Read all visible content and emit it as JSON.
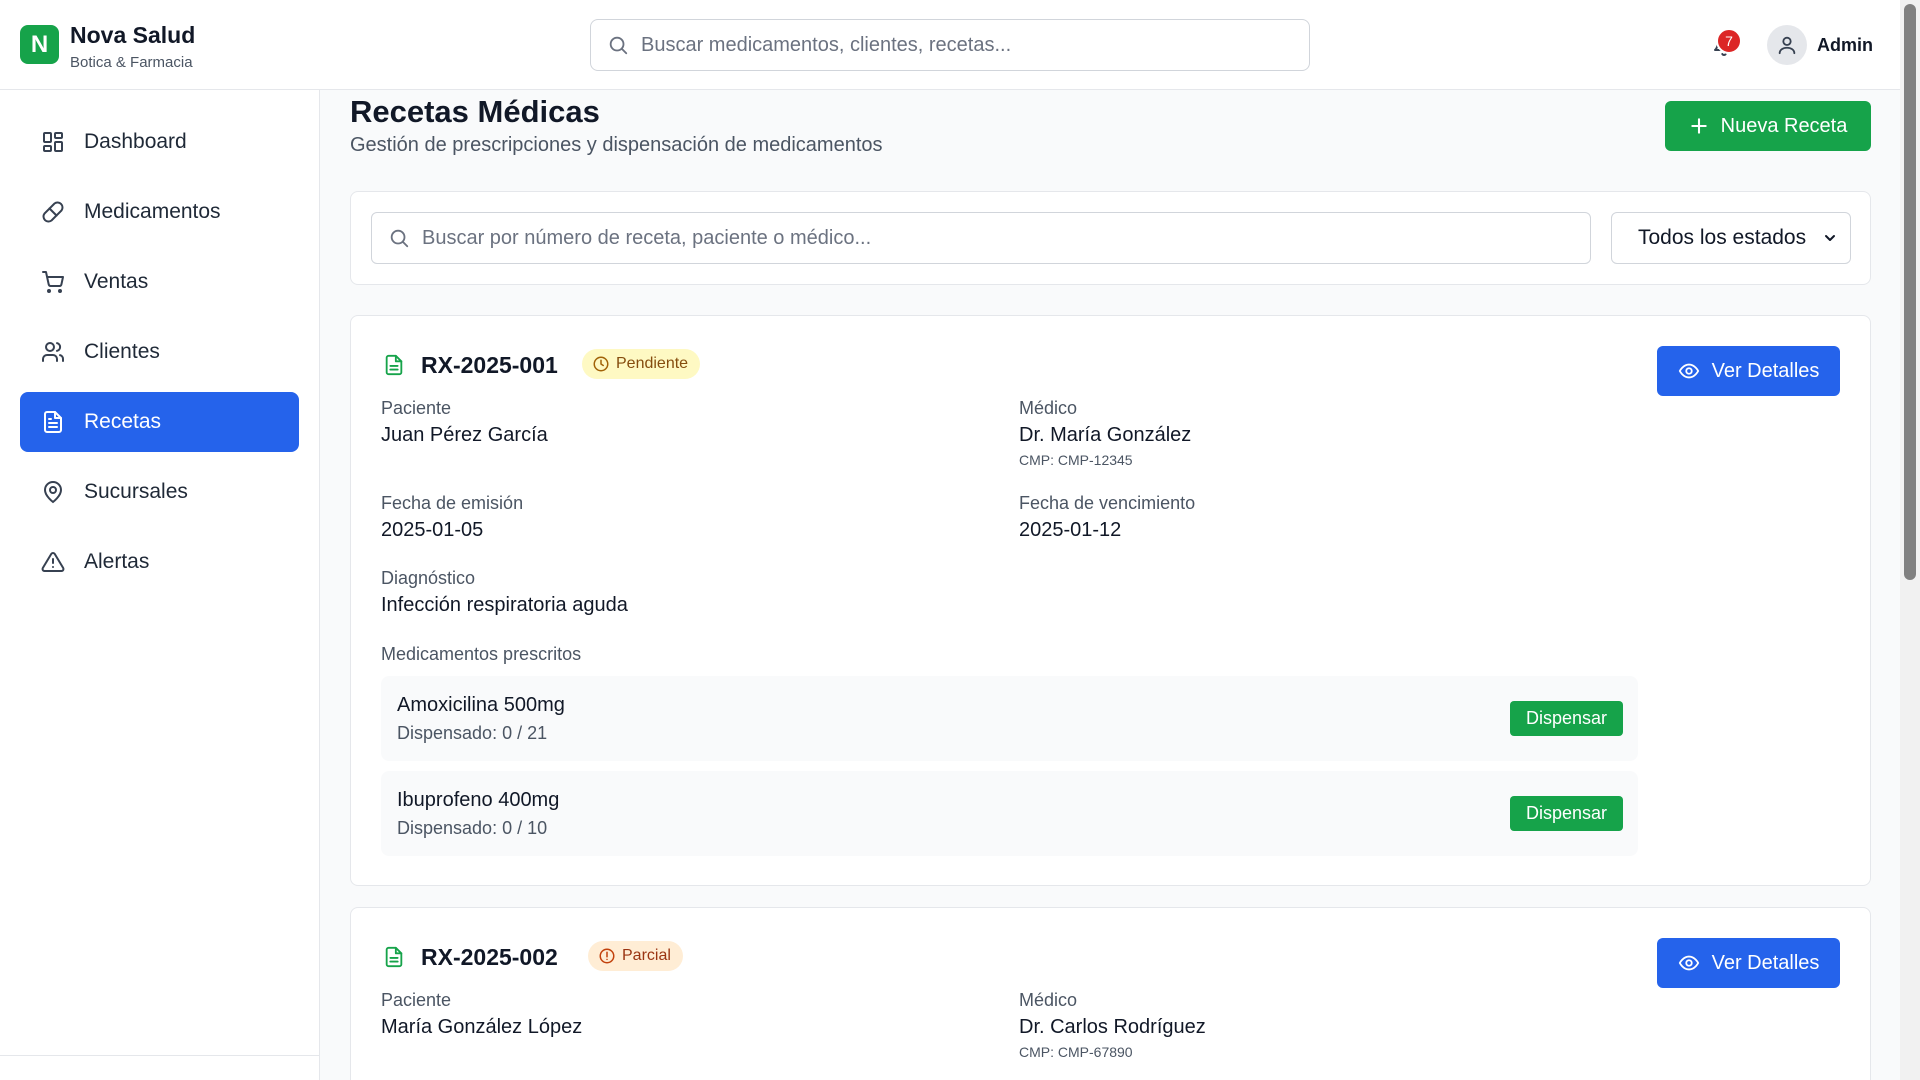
{
  "brand": {
    "logo_letter": "N",
    "name": "Nova Salud",
    "subtitle": "Botica & Farmacia"
  },
  "header": {
    "search_placeholder": "Buscar medicamentos, clientes, recetas...",
    "notification_count": "7",
    "user_label": "Admin"
  },
  "sidebar": {
    "items": [
      {
        "label": "Dashboard",
        "icon": "dashboard-icon",
        "active": false
      },
      {
        "label": "Medicamentos",
        "icon": "pill-icon",
        "active": false
      },
      {
        "label": "Ventas",
        "icon": "cart-icon",
        "active": false
      },
      {
        "label": "Clientes",
        "icon": "users-icon",
        "active": false
      },
      {
        "label": "Recetas",
        "icon": "file-text-icon",
        "active": true
      },
      {
        "label": "Sucursales",
        "icon": "map-pin-icon",
        "active": false
      },
      {
        "label": "Alertas",
        "icon": "alert-triangle-icon",
        "active": false
      }
    ]
  },
  "page": {
    "title": "Recetas Médicas",
    "subtitle": "Gestión de prescripciones y dispensación de medicamentos",
    "new_button": "Nueva Receta"
  },
  "filters": {
    "search_placeholder": "Buscar por número de receta, paciente o médico...",
    "state_selected": "Todos los estados"
  },
  "labels": {
    "patient": "Paciente",
    "doctor": "Médico",
    "issue_date": "Fecha de emisión",
    "expiry_date": "Fecha de vencimiento",
    "diagnosis": "Diagnóstico",
    "prescribed": "Medicamentos prescritos",
    "details_button": "Ver Detalles",
    "dispense_button": "Dispensar"
  },
  "prescriptions": [
    {
      "code": "RX-2025-001",
      "status": "Pendiente",
      "patient": "Juan Pérez García",
      "doctor": "Dr. María González",
      "cmp": "CMP: CMP-12345",
      "issue_date": "2025-01-05",
      "expiry_date": "2025-01-12",
      "diagnosis": "Infección respiratoria aguda",
      "medications": [
        {
          "name": "Amoxicilina 500mg",
          "dispensed": "Dispensado: 0 / 21"
        },
        {
          "name": "Ibuprofeno 400mg",
          "dispensed": "Dispensado: 0 / 10"
        }
      ]
    },
    {
      "code": "RX-2025-002",
      "status": "Parcial",
      "patient": "María González López",
      "doctor": "Dr. Carlos Rodríguez",
      "cmp": "CMP: CMP-67890"
    }
  ],
  "colors": {
    "brand_green": "#16a34a",
    "primary_blue": "#2563eb",
    "badge_pending_bg": "#fef9c3",
    "badge_partial_bg": "#ffedd5",
    "notification_red": "#dc2626"
  }
}
